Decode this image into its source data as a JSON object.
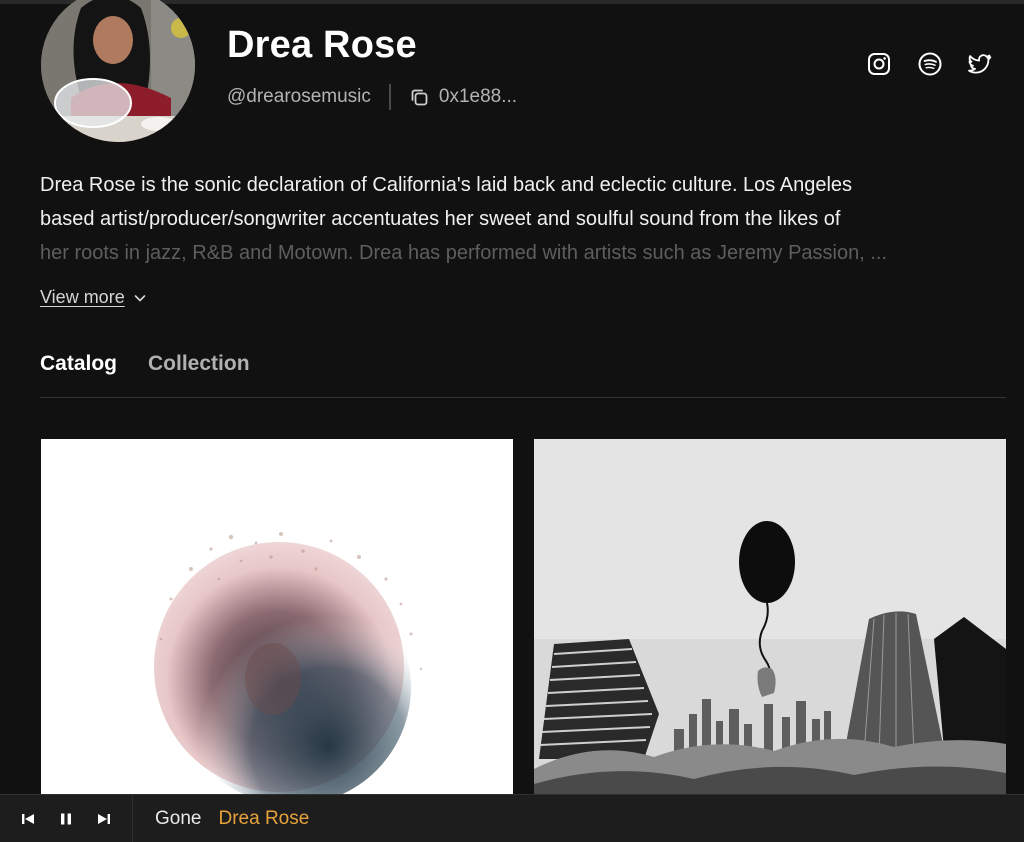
{
  "artist": {
    "name": "Drea Rose",
    "handle": "@drearosemusic",
    "wallet_short": "0x1e88..."
  },
  "social": {
    "instagram_icon": "instagram-icon",
    "spotify_icon": "spotify-icon",
    "twitter_icon": "twitter-icon"
  },
  "bio": {
    "line1": "Drea Rose is the sonic declaration of California's laid back and eclectic culture. Los Angeles",
    "line2": "based artist/producer/songwriter accentuates her sweet and soulful sound from the likes of",
    "line3": "her roots in jazz, R&B and Motown. Drea has performed with artists such as Jeremy Passion, ...",
    "view_more": "View more"
  },
  "tabs": [
    {
      "label": "Catalog",
      "active": true
    },
    {
      "label": "Collection",
      "active": false
    }
  ],
  "player": {
    "track_title": "Gone",
    "track_artist": "Drea Rose",
    "state": "playing"
  },
  "colors": {
    "background": "#111111",
    "accent": "#e8a23b",
    "text": "#ffffff",
    "muted": "#b3b3b3"
  }
}
